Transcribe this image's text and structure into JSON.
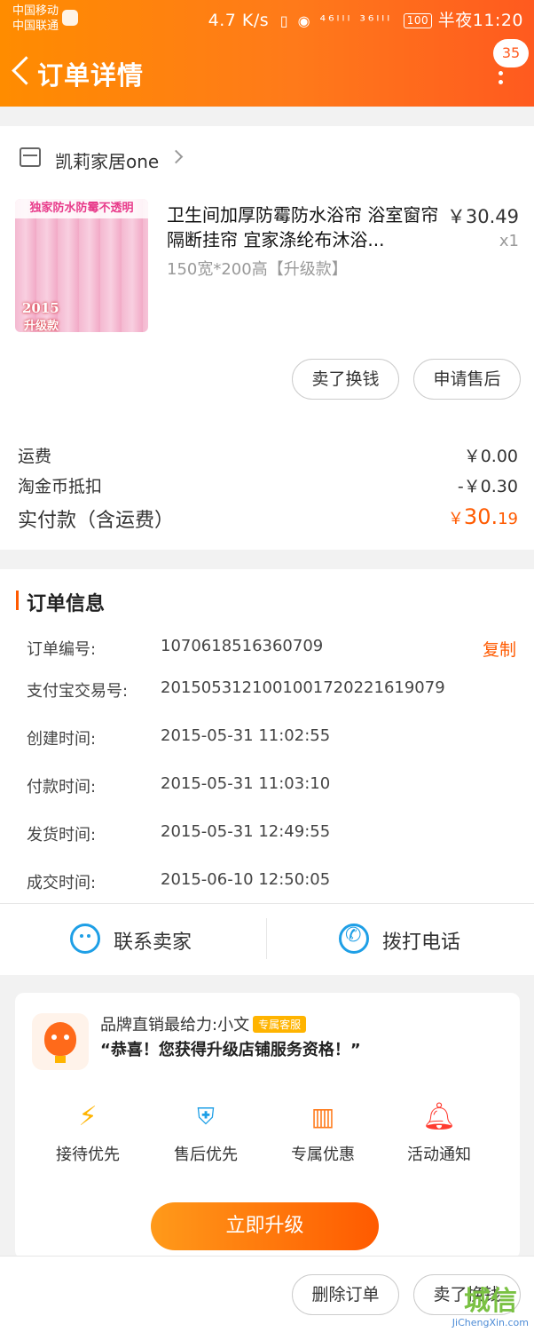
{
  "status_bar": {
    "carrier1": "中国移动",
    "carrier2": "中国联通",
    "speed": "4.7 K/s",
    "icons": "▯ ◉ ⁴⁶ᴵᴵᴵ ³⁶ᴵᴵᴵ",
    "battery": "100",
    "time": "半夜11:20"
  },
  "header": {
    "title": "订单详情",
    "badge_count": "35"
  },
  "shop": {
    "name": "凯莉家居one"
  },
  "product": {
    "image_banner": "独家防水防霉不透明",
    "image_year": "2015",
    "image_sub": "升级款",
    "title": "卫生间加厚防霉防水浴帘 浴室窗帘隔断挂帘 宜家涤纶布沐浴...",
    "spec": "150宽*200高【升级款】",
    "price": "￥30.49",
    "quantity": "x1"
  },
  "item_actions": {
    "resell": "卖了换钱",
    "after_sale": "申请售后"
  },
  "fees": {
    "shipping_label": "运费",
    "shipping_value": "￥0.00",
    "coin_label": "淘金币抵扣",
    "coin_value": "-￥0.30",
    "total_label": "实付款（含运费）",
    "total_currency": "￥",
    "total_int": "30.",
    "total_dec": "19"
  },
  "order_info": {
    "title": "订单信息",
    "copy": "复制",
    "rows": [
      {
        "label": "订单编号:",
        "value": "1070618516360709"
      },
      {
        "label": "支付宝交易号:",
        "value": "2015053121001001720221619079"
      },
      {
        "label": "创建时间:",
        "value": "2015-05-31 11:02:55"
      },
      {
        "label": "付款时间:",
        "value": "2015-05-31 11:03:10"
      },
      {
        "label": "发货时间:",
        "value": "2015-05-31 12:49:55"
      },
      {
        "label": "成交时间:",
        "value": "2015-06-10 12:50:05"
      }
    ]
  },
  "contact": {
    "seller": "联系卖家",
    "call": "拨打电话"
  },
  "service": {
    "name": "品牌直销最给力:小文",
    "tag": "专属客服",
    "message": "“恭喜！您获得升级店铺服务资格！”",
    "perks": [
      {
        "label": "接待优先",
        "icon": "lightning-icon"
      },
      {
        "label": "售后优先",
        "icon": "shield-icon"
      },
      {
        "label": "专属优惠",
        "icon": "coupon-icon"
      },
      {
        "label": "活动通知",
        "icon": "bell-icon"
      }
    ],
    "upgrade": "立即升级"
  },
  "bottom_actions": {
    "delete": "删除订单",
    "resell": "卖了换钱"
  },
  "watermark": {
    "logo": "城信",
    "url": "JiChengXin.com"
  },
  "colors": {
    "accent": "#ff5a00",
    "header_start": "#ff8c00",
    "link_blue": "#1e9fe6"
  }
}
